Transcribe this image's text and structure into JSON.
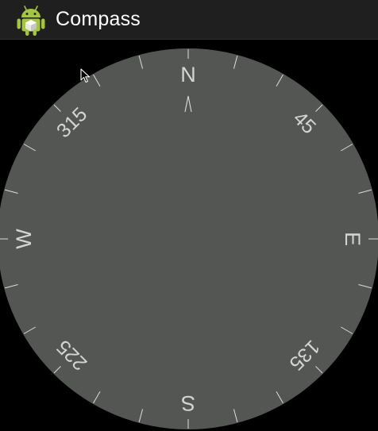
{
  "app": {
    "title": "Compass",
    "icon": "android-robot-icon"
  },
  "compass": {
    "heading": 0,
    "cardinals": [
      {
        "label": "N",
        "angle": 0
      },
      {
        "label": "E",
        "angle": 90
      },
      {
        "label": "S",
        "angle": 180
      },
      {
        "label": "W",
        "angle": 270
      }
    ],
    "degree_labels": [
      {
        "label": "45",
        "angle": 45
      },
      {
        "label": "135",
        "angle": 135
      },
      {
        "label": "225",
        "angle": 225
      },
      {
        "label": "315",
        "angle": 315
      }
    ],
    "tick_step_degrees": 15,
    "pointer": "north-chevron",
    "colors": {
      "face": "#545654",
      "tick": "#dcdcdc",
      "label": "#d4d4d4"
    }
  }
}
